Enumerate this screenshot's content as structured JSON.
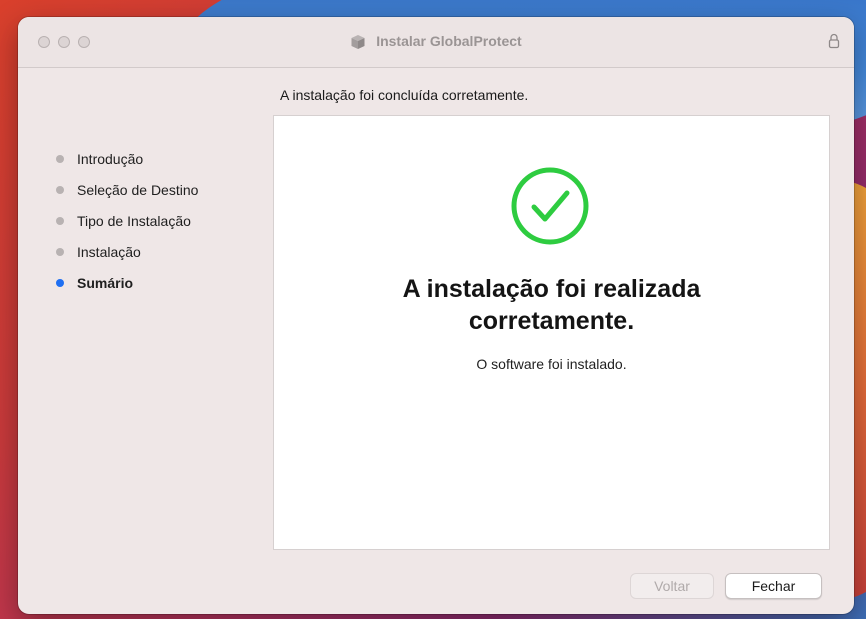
{
  "window": {
    "title": "Instalar GlobalProtect"
  },
  "header": {
    "status_text": "A instalação foi concluída corretamente."
  },
  "sidebar": {
    "steps": [
      {
        "label": "Introdução",
        "active": false
      },
      {
        "label": "Seleção de Destino",
        "active": false
      },
      {
        "label": "Tipo de Instalação",
        "active": false
      },
      {
        "label": "Instalação",
        "active": false
      },
      {
        "label": "Sumário",
        "active": true
      }
    ]
  },
  "main": {
    "success_title_line1": "A instalação foi realizada",
    "success_title_line2": "corretamente.",
    "success_subtitle": "O software foi instalado."
  },
  "footer": {
    "back_label": "Voltar",
    "close_label": "Fechar"
  },
  "icons": {
    "title": "package-icon",
    "lock": "lock-icon",
    "status": "checkmark-circle-icon"
  },
  "colors": {
    "success": "#2ecc40",
    "active_step": "#1f6ff2",
    "inactive_step": "#b8b2b2"
  }
}
